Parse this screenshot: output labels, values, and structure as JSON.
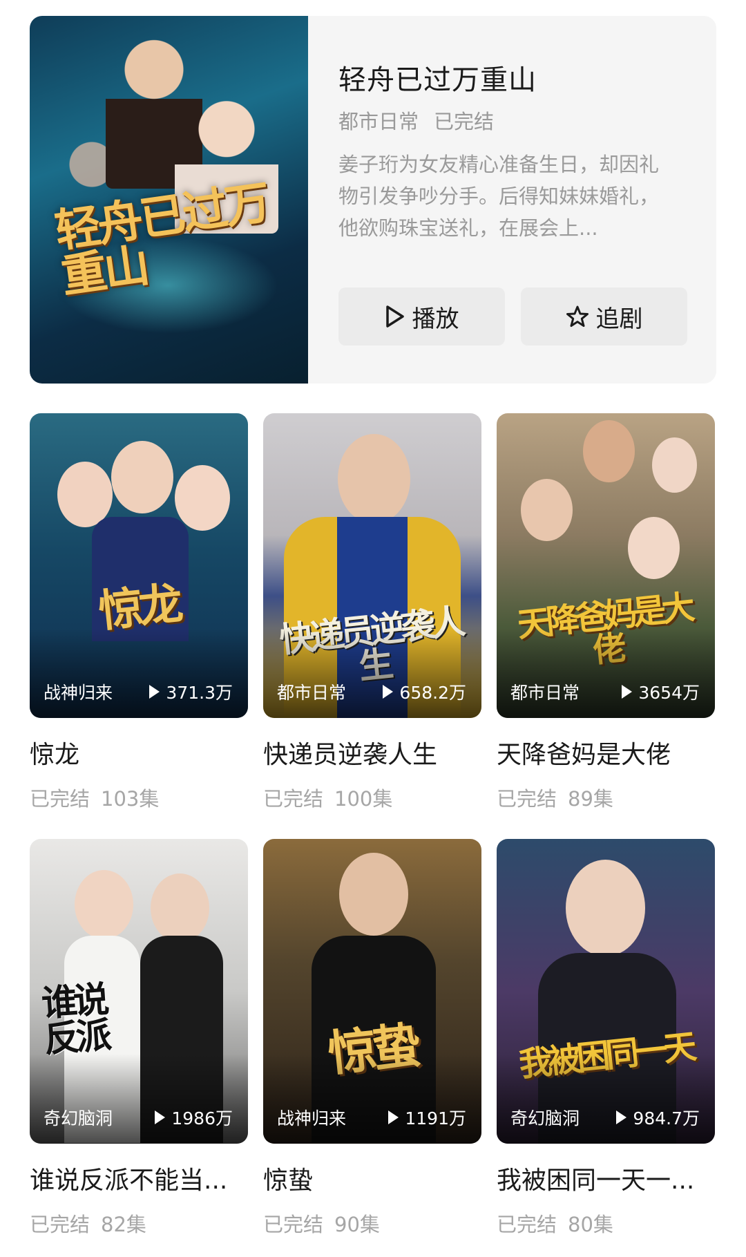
{
  "featured": {
    "title": "轻舟已过万重山",
    "genre": "都市日常",
    "status": "已完结",
    "description": "姜子珩为女友精心准备生日，却因礼物引发争吵分手。后得知妹妹婚礼，他欲购珠宝送礼，在展会上...",
    "poster_art_text": "轻舟已过万重山",
    "play_label": "播放",
    "follow_label": "追剧",
    "icons": {
      "play": "play-outline-icon",
      "follow": "star-outline-icon"
    }
  },
  "dramas": [
    {
      "title": "惊龙",
      "genre": "战神归来",
      "plays": "371.3万",
      "status": "已完结",
      "episodes": "103集",
      "art": "惊龙"
    },
    {
      "title": "快递员逆袭人生",
      "genre": "都市日常",
      "plays": "658.2万",
      "status": "已完结",
      "episodes": "100集",
      "art": "快递员逆袭人生"
    },
    {
      "title": "天降爸妈是大佬",
      "genre": "都市日常",
      "plays": "3654万",
      "status": "已完结",
      "episodes": "89集",
      "art": "天降爸妈是大佬"
    },
    {
      "title": "谁说反派不能当...",
      "genre": "奇幻脑洞",
      "plays": "1986万",
      "status": "已完结",
      "episodes": "82集",
      "art": "谁说反派"
    },
    {
      "title": "惊蛰",
      "genre": "战神归来",
      "plays": "1191万",
      "status": "已完结",
      "episodes": "90集",
      "art": "惊蛰"
    },
    {
      "title": "我被困同一天一...",
      "genre": "奇幻脑洞",
      "plays": "984.7万",
      "status": "已完结",
      "episodes": "80集",
      "art": "我被困同一天"
    }
  ],
  "colors": {
    "title": "#1a1a1a",
    "meta": "#999999",
    "button_bg": "#ebebeb",
    "card_bg": "#f5f5f5",
    "art_gold": "#f0c55b"
  }
}
